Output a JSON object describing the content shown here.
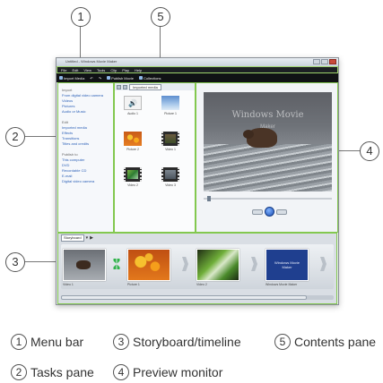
{
  "callouts": [
    "1",
    "2",
    "3",
    "4",
    "5"
  ],
  "window": {
    "title": "Untitled - Windows Movie Maker",
    "menu": [
      "File",
      "Edit",
      "View",
      "Tools",
      "Clip",
      "Play",
      "Help"
    ],
    "toolbar": [
      "Import Media",
      "↶",
      "↷",
      "Publish Movie",
      "Collections"
    ]
  },
  "tasks": {
    "groups": [
      {
        "head": "Import",
        "items": [
          "From digital video camera",
          "Videos",
          "Pictures",
          "Audio or Music"
        ]
      },
      {
        "head": "Edit",
        "items": [
          "Imported media",
          "Effects",
          "Transitions",
          "Titles and credits"
        ]
      },
      {
        "head": "Publish to",
        "items": [
          "This computer",
          "DVD",
          "Recordable CD",
          "E-mail",
          "Digital video camera"
        ]
      }
    ]
  },
  "contents": {
    "selector": "Imported media",
    "clips": [
      {
        "name": "Audio 1",
        "icon": "speaker-icon"
      },
      {
        "name": "Picture 1"
      },
      {
        "name": "Picture 2"
      },
      {
        "name": "Video 1"
      },
      {
        "name": "Video 2"
      },
      {
        "name": "Video 3"
      }
    ]
  },
  "preview": {
    "overlay_title": "Windows Movie",
    "overlay_sub": "Maker"
  },
  "storyboard": {
    "view_selector": "Storyboard",
    "items": [
      "Video 1",
      "Picture 1",
      "Video 2",
      "Windows Movie Maker"
    ],
    "title_card_line1": "Windows Movie",
    "title_card_line2": "Maker"
  },
  "legend": [
    {
      "num": "1",
      "text": "Menu bar"
    },
    {
      "num": "3",
      "text": "Storyboard/timeline"
    },
    {
      "num": "5",
      "text": "Contents pane"
    },
    {
      "num": "2",
      "text": "Tasks pane"
    },
    {
      "num": "4",
      "text": "Preview monitor"
    }
  ],
  "colors": {
    "highlight_border": "#83c84f",
    "menubar": "#1c1f24",
    "title_card": "#1f3f8f"
  }
}
